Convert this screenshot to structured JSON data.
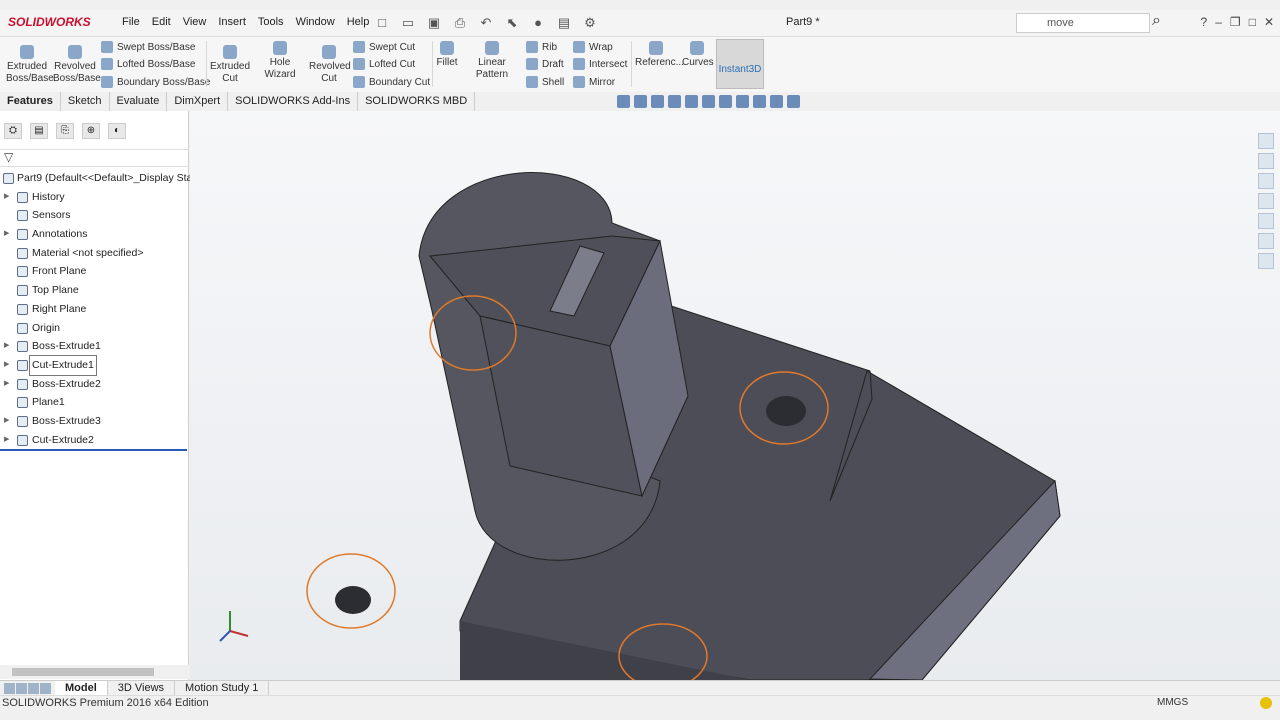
{
  "app": {
    "logo": "SOLIDWORKS",
    "doc_title": "Part9 *"
  },
  "menu": [
    "File",
    "Edit",
    "View",
    "Insert",
    "Tools",
    "Window",
    "Help"
  ],
  "search": {
    "value": "move"
  },
  "ribbon": {
    "extruded_boss": "Extruded\nBoss/Base",
    "revolved_boss": "Revolved\nBoss/Base",
    "swept_boss": "Swept Boss/Base",
    "lofted_boss": "Lofted Boss/Base",
    "boundary_boss": "Boundary Boss/Base",
    "extruded_cut": "Extruded\nCut",
    "hole_wizard": "Hole Wizard",
    "revolved_cut": "Revolved\nCut",
    "swept_cut": "Swept Cut",
    "lofted_cut": "Lofted Cut",
    "boundary_cut": "Boundary Cut",
    "fillet": "Fillet",
    "linear_pattern": "Linear Pattern",
    "rib": "Rib",
    "draft": "Draft",
    "shell": "Shell",
    "wrap": "Wrap",
    "intersect": "Intersect",
    "mirror": "Mirror",
    "reference": "Referenc...",
    "curves": "Curves",
    "instant3d": "Instant3D"
  },
  "tabs": [
    "Features",
    "Sketch",
    "Evaluate",
    "DimXpert",
    "SOLIDWORKS Add-Ins",
    "SOLIDWORKS MBD"
  ],
  "tree": {
    "root": "Part9  (Default<<Default>_Display Sta",
    "items": [
      "History",
      "Sensors",
      "Annotations",
      "Material <not specified>",
      "Front Plane",
      "Top Plane",
      "Right Plane",
      "Origin",
      "Boss-Extrude1",
      "Cut-Extrude1",
      "Boss-Extrude2",
      "Plane1",
      "Boss-Extrude3",
      "Cut-Extrude2"
    ]
  },
  "bottom_tabs": [
    "Model",
    "3D Views",
    "Motion Study 1"
  ],
  "status": {
    "edition": "SOLIDWORKS Premium 2016 x64 Edition",
    "units": "MMGS"
  }
}
